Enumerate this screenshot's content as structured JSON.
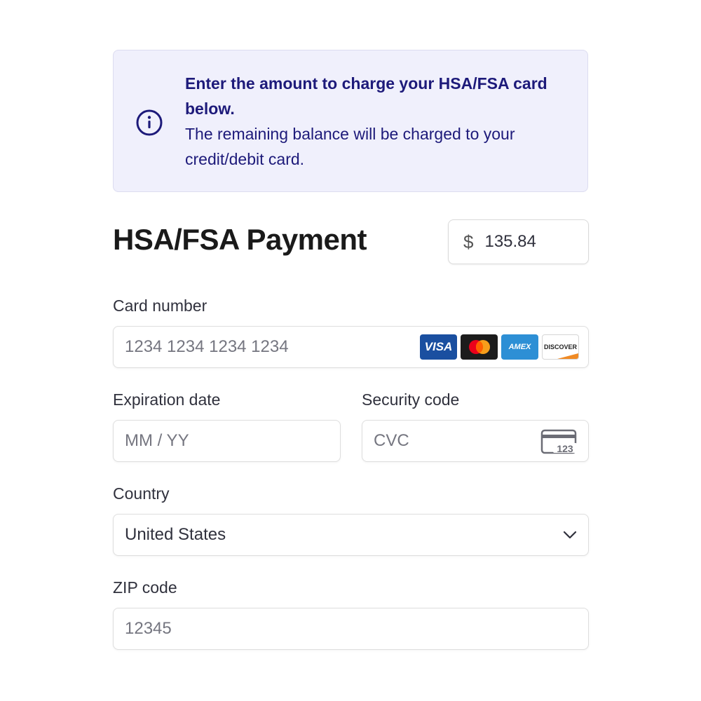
{
  "banner": {
    "bold_text": "Enter the amount to charge your HSA/FSA card below.",
    "normal_text": "The remaining balance will be charged to your credit/debit card.",
    "icon": "info-icon",
    "background_color": "#f0f0fc",
    "text_color": "#1d1a7a"
  },
  "payment": {
    "title": "HSA/FSA Payment",
    "currency_symbol": "$",
    "amount": "135.84"
  },
  "card_number": {
    "label": "Card number",
    "placeholder": "1234 1234 1234 1234",
    "brands": [
      {
        "name": "visa-logo",
        "text": "VISA",
        "color": "#1a4fa0"
      },
      {
        "name": "mastercard-logo",
        "text": "",
        "color": "#1c1c1c"
      },
      {
        "name": "amex-logo",
        "text": "AMEX",
        "color": "#2d8fd5"
      },
      {
        "name": "discover-logo",
        "text": "DISCOVER",
        "color": "#f08a24"
      }
    ]
  },
  "expiration": {
    "label": "Expiration date",
    "placeholder": "MM / YY"
  },
  "security": {
    "label": "Security code",
    "placeholder": "CVC",
    "icon_text": "123",
    "icon": "cvc-card-icon"
  },
  "country": {
    "label": "Country",
    "value": "United States",
    "icon": "chevron-down-icon"
  },
  "zip": {
    "label": "ZIP code",
    "placeholder": "12345"
  }
}
